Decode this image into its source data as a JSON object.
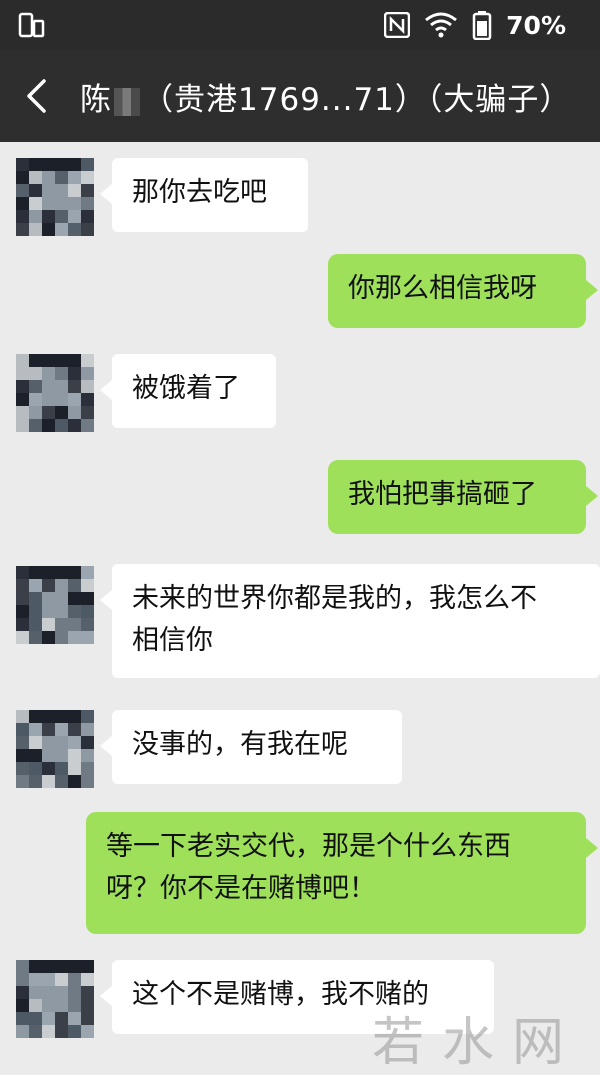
{
  "status_bar": {
    "battery_percent": "70%",
    "icons": [
      "sim-icon",
      "nfc-icon",
      "wifi-icon",
      "battery-icon"
    ]
  },
  "header": {
    "title_prefix": "陈",
    "title_suffix": "（贵港1769...71）（大骗子）"
  },
  "messages": [
    {
      "side": "in",
      "text": "那你去吃吧"
    },
    {
      "side": "out",
      "text": "你那么相信我呀"
    },
    {
      "side": "in",
      "text": "被饿着了"
    },
    {
      "side": "out",
      "text": "我怕把事搞砸了"
    },
    {
      "side": "in",
      "text": "未来的世界你都是我的，我怎么不\n相信你"
    },
    {
      "side": "in",
      "text": "没事的，有我在呢"
    },
    {
      "side": "out",
      "text": "等一下老实交代，那是个什么东西\n呀？你不是在赌博吧！"
    },
    {
      "side": "in",
      "text": "这个不是赌博，我不赌的"
    }
  ],
  "watermark": "若水网",
  "colors": {
    "chat_bg": "#ebebeb",
    "header_bg": "#2e2e2e",
    "outgoing_bubble": "#9fe05a",
    "incoming_bubble": "#ffffff"
  }
}
